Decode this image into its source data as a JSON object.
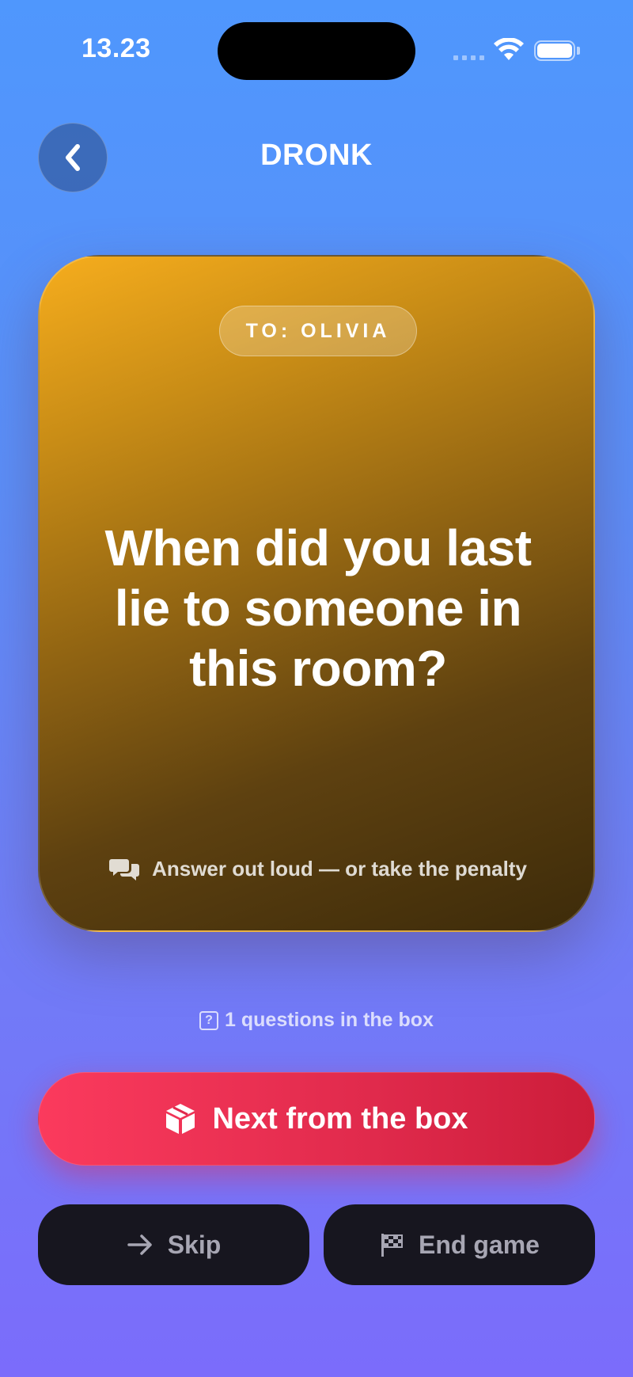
{
  "status_bar": {
    "time": "13.23"
  },
  "header": {
    "title": "DRONK",
    "back_icon": "chevron-left-icon"
  },
  "card": {
    "recipient": "TO: OLIVIA",
    "question": "When did you last lie to someone in this room?",
    "hint": "Answer out loud — or take the penalty",
    "hint_icon": "speech-bubbles-icon",
    "gradient": [
      "#f6ad1d",
      "#3d2b0a"
    ]
  },
  "counter": {
    "text": "1 questions in the box",
    "icon": "question-box-icon"
  },
  "actions": {
    "next_label": "Next from the box",
    "next_icon": "package-icon",
    "skip_label": "Skip",
    "skip_icon": "arrow-right-icon",
    "end_label": "End game",
    "end_icon": "checkered-flag-icon"
  },
  "colors": {
    "primary": "#e02a4c",
    "secondary_button": "#17161f",
    "background_top": "#4f97fd",
    "background_bottom": "#7b6cfb"
  }
}
